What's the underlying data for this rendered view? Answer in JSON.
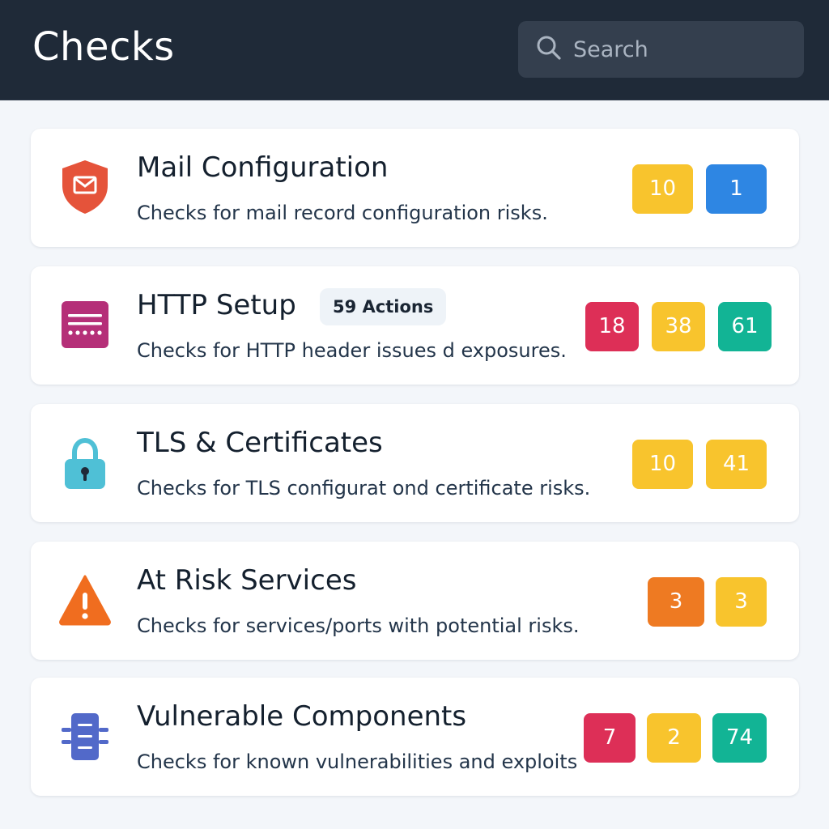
{
  "header": {
    "title": "Checks",
    "search_placeholder": "Search"
  },
  "colors": {
    "header_bg": "#1f2a38",
    "yellow": "#f8c42d",
    "blue": "#2e86e3",
    "red": "#dd2f57",
    "green": "#12b495",
    "orange": "#ee7a22"
  },
  "checks": [
    {
      "title": "Mail Configuration",
      "description": "Checks for mail record configuration risks.",
      "icon": "mail-shield-icon",
      "badges": [
        {
          "value": "10",
          "color": "yellow"
        },
        {
          "value": "1",
          "color": "blue"
        }
      ]
    },
    {
      "title": "HTTP Setup",
      "actions": "59 Actions",
      "description": "Checks for HTTP header issues d exposures.",
      "icon": "http-window-icon",
      "badges": [
        {
          "value": "18",
          "color": "red"
        },
        {
          "value": "38",
          "color": "yellow"
        },
        {
          "value": "61",
          "color": "green"
        }
      ]
    },
    {
      "title": "TLS & Certificates",
      "description": "Checks for TLS configurat ond certificate risks.",
      "icon": "lock-icon",
      "badges": [
        {
          "value": "10",
          "color": "yellow"
        },
        {
          "value": "41",
          "color": "yellow"
        }
      ]
    },
    {
      "title": "At Risk Services",
      "description": "Checks for services/ports with potential risks.",
      "icon": "warning-icon",
      "badges": [
        {
          "value": "3",
          "color": "orange"
        },
        {
          "value": "3",
          "color": "yellow"
        }
      ]
    },
    {
      "title": "Vulnerable Components",
      "description": "Checks for known vulnerabilities and exploits",
      "icon": "component-chip-icon",
      "badges": [
        {
          "value": "7",
          "color": "red"
        },
        {
          "value": "2",
          "color": "yellow"
        },
        {
          "value": "74",
          "color": "green"
        }
      ]
    }
  ]
}
